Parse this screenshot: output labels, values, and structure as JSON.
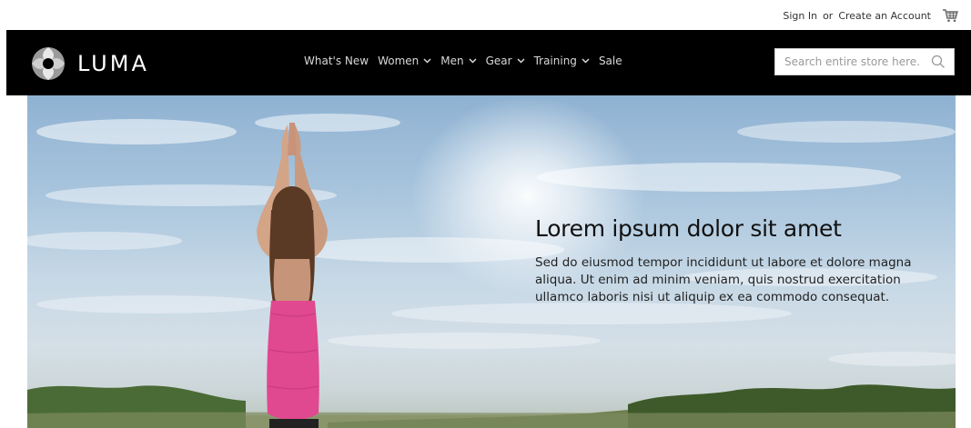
{
  "topbar": {
    "sign_in": "Sign In",
    "or": "or",
    "create_account": "Create an Account",
    "cart_icon": "cart-icon"
  },
  "header": {
    "logo_text": "LUMA",
    "logo_icon": "luma-logo-icon",
    "nav": [
      {
        "label": "What's New",
        "has_dropdown": false
      },
      {
        "label": "Women",
        "has_dropdown": true
      },
      {
        "label": "Men",
        "has_dropdown": true
      },
      {
        "label": "Gear",
        "has_dropdown": true
      },
      {
        "label": "Training",
        "has_dropdown": true
      },
      {
        "label": "Sale",
        "has_dropdown": false
      }
    ],
    "search": {
      "placeholder": "Search entire store here...",
      "value": "",
      "icon": "search-icon"
    }
  },
  "hero": {
    "title": "Lorem ipsum dolor sit amet",
    "body": "Sed do eiusmod tempor incididunt ut labore et dolore magna aliqua. Ut enim ad minim veniam, quis nostrud exercitation ullamco laboris nisi ut aliquip ex ea commodo consequat."
  },
  "colors": {
    "header_bg": "#000000",
    "nav_text": "#d8d8d8",
    "shirt": "#e0488f"
  }
}
